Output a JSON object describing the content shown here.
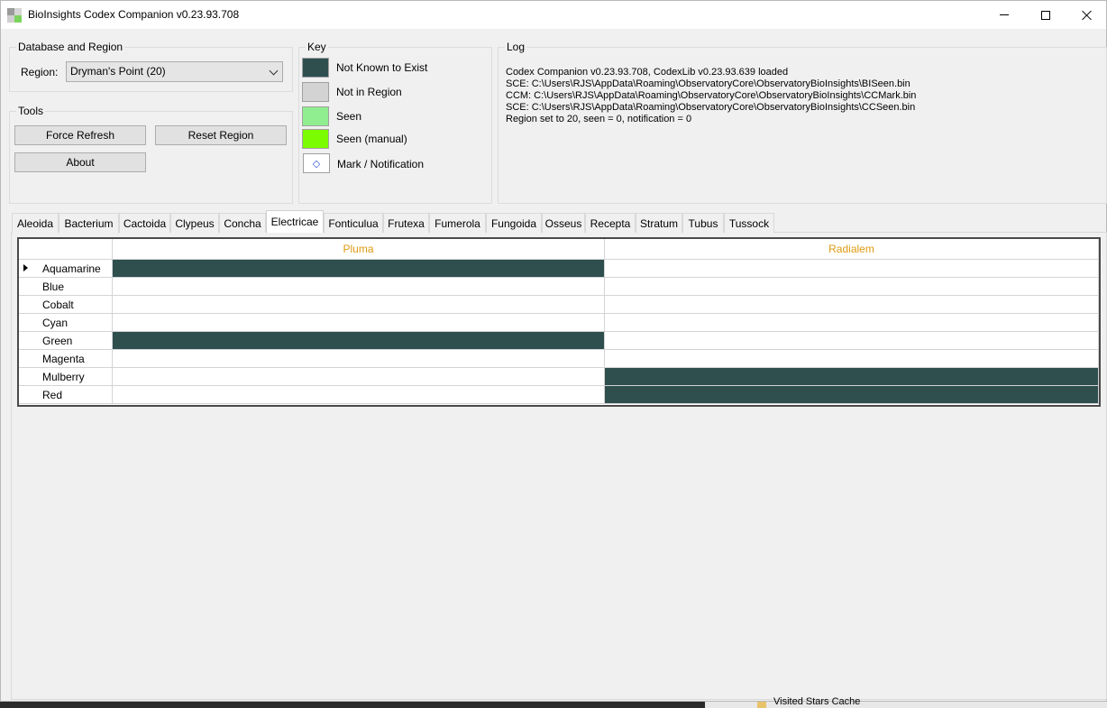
{
  "window": {
    "title": "BioInsights Codex Companion v0.23.93.708"
  },
  "database_group": {
    "title": "Database and Region",
    "region_label": "Region:",
    "region_value": "Dryman's Point (20)"
  },
  "tools_group": {
    "title": "Tools",
    "force_refresh": "Force Refresh",
    "reset_region": "Reset Region",
    "about": "About"
  },
  "key_group": {
    "title": "Key",
    "items": [
      {
        "label": "Not Known to Exist",
        "color": "#2f4f4f"
      },
      {
        "label": "Not in Region",
        "color": "#d3d3d3"
      },
      {
        "label": "Seen",
        "color": "#90ee90"
      },
      {
        "label": "Seen (manual)",
        "color": "#7cfc00"
      },
      {
        "label": "Mark / Notification",
        "color": "#ffffff",
        "glyph": "◇"
      }
    ]
  },
  "log_group": {
    "title": "Log",
    "lines": [
      "Codex Companion v0.23.93.708, CodexLib v0.23.93.639 loaded",
      "SCE: C:\\Users\\RJS\\AppData\\Roaming\\ObservatoryCore\\ObservatoryBioInsights\\BISeen.bin",
      "CCM: C:\\Users\\RJS\\AppData\\Roaming\\ObservatoryCore\\ObservatoryBioInsights\\CCMark.bin",
      "SCE: C:\\Users\\RJS\\AppData\\Roaming\\ObservatoryCore\\ObservatoryBioInsights\\CCSeen.bin",
      "Region set to 20, seen = 0, notification = 0"
    ]
  },
  "tabs": [
    {
      "label": "Aleoida"
    },
    {
      "label": "Bacterium"
    },
    {
      "label": "Cactoida"
    },
    {
      "label": "Clypeus"
    },
    {
      "label": "Concha"
    },
    {
      "label": "Electricae",
      "active": true
    },
    {
      "label": "Fonticulua"
    },
    {
      "label": "Frutexa"
    },
    {
      "label": "Fumerola"
    },
    {
      "label": "Fungoida"
    },
    {
      "label": "Osseus"
    },
    {
      "label": "Recepta"
    },
    {
      "label": "Stratum"
    },
    {
      "label": "Tubus"
    },
    {
      "label": "Tussock"
    }
  ],
  "grid": {
    "columns": [
      "Pluma",
      "Radialem"
    ],
    "rows": [
      {
        "name": "Aquamarine",
        "cells": [
          "Not Known to Exist",
          ""
        ],
        "current": true
      },
      {
        "name": "Blue",
        "cells": [
          "",
          ""
        ]
      },
      {
        "name": "Cobalt",
        "cells": [
          "",
          ""
        ]
      },
      {
        "name": "Cyan",
        "cells": [
          "",
          ""
        ]
      },
      {
        "name": "Green",
        "cells": [
          "Not Known to Exist",
          ""
        ]
      },
      {
        "name": "Magenta",
        "cells": [
          "",
          ""
        ]
      },
      {
        "name": "Mulberry",
        "cells": [
          "",
          "Not Known to Exist"
        ]
      },
      {
        "name": "Red",
        "cells": [
          "",
          "Not Known to Exist"
        ]
      }
    ]
  },
  "background": {
    "taskbar_item": "Visited Stars Cache"
  }
}
